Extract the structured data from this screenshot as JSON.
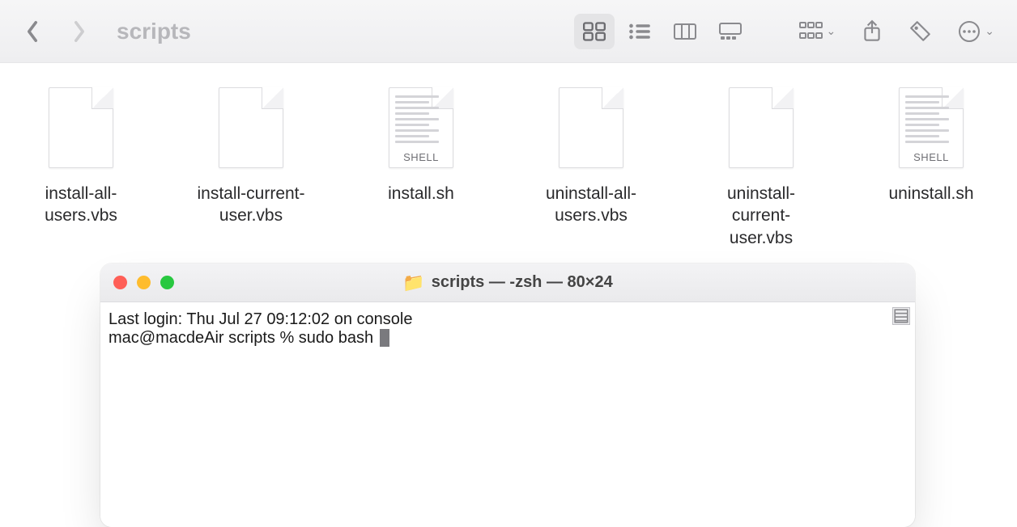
{
  "finder": {
    "title": "scripts",
    "files": [
      {
        "name": "install-all-users.vbs",
        "kind": "plain"
      },
      {
        "name": "install-current-user.vbs",
        "kind": "plain"
      },
      {
        "name": "install.sh",
        "kind": "shell",
        "tag": "SHELL"
      },
      {
        "name": "uninstall-all-users.vbs",
        "kind": "plain"
      },
      {
        "name": "uninstall-current-user.vbs",
        "kind": "plain"
      },
      {
        "name": "uninstall.sh",
        "kind": "shell",
        "tag": "SHELL"
      }
    ]
  },
  "terminal": {
    "title": "scripts — -zsh — 80×24",
    "last_login": "Last login: Thu Jul 27 09:12:02 on console",
    "prompt": "mac@macdeAir scripts % sudo bash "
  }
}
